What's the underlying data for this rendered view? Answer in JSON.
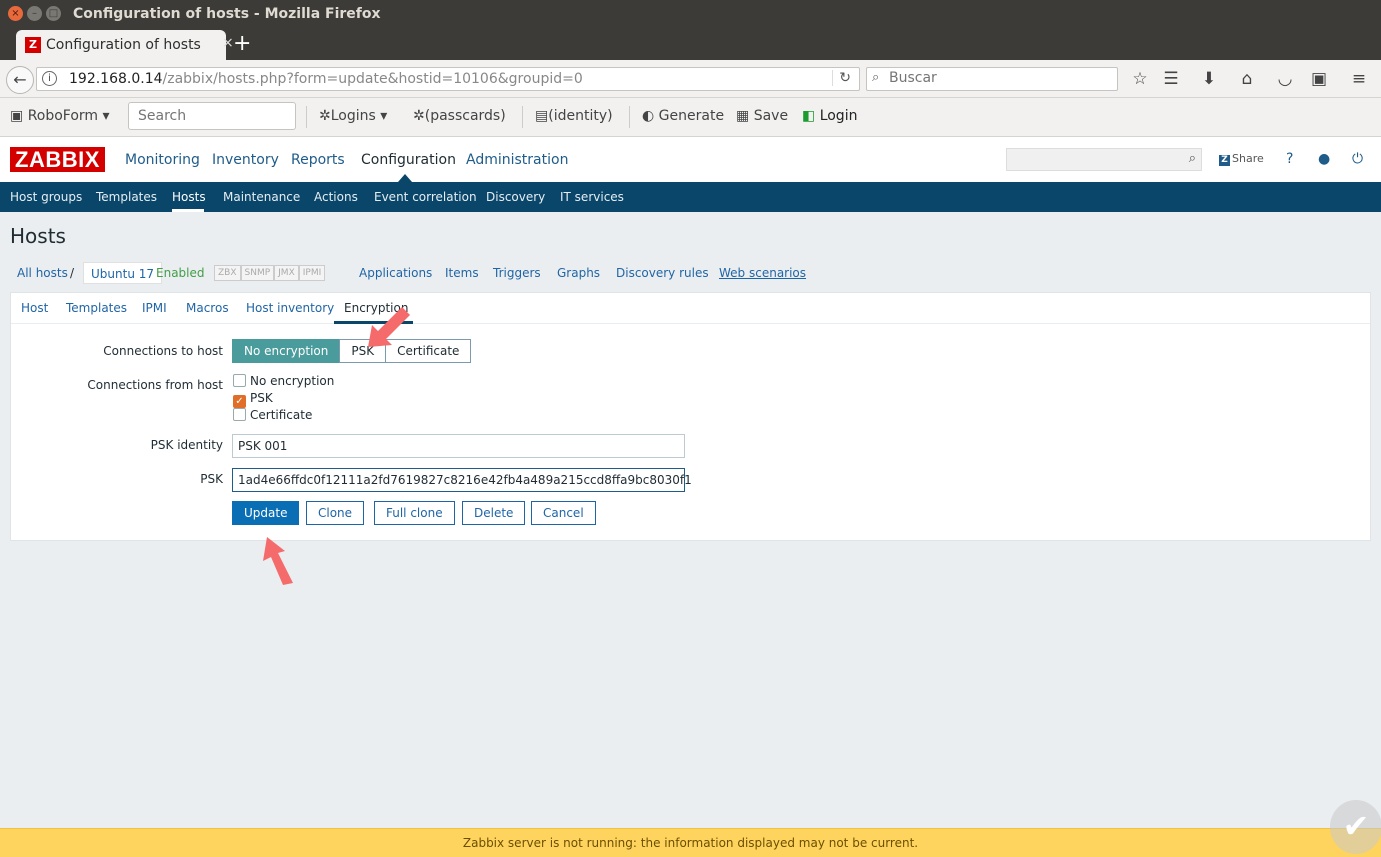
{
  "window": {
    "title": "Configuration of hosts - Mozilla Firefox",
    "tab_label": "Configuration of hosts",
    "tab_favicon": "Z"
  },
  "nav": {
    "url_host": "192.168.0.14",
    "url_path": "/zabbix/hosts.php?form=update&hostid=10106&groupid=0",
    "search_placeholder": "Buscar"
  },
  "roboform": {
    "brand": "RoboForm",
    "search_placeholder": "Search",
    "logins": "Logins",
    "passcards": "(passcards)",
    "identity": "(identity)",
    "generate": "Generate",
    "save": "Save",
    "login": "Login"
  },
  "zabbix": {
    "logo": "ZABBIX",
    "main_menu": [
      "Monitoring",
      "Inventory",
      "Reports",
      "Configuration",
      "Administration"
    ],
    "share": "Share",
    "sub_menu": [
      "Host groups",
      "Templates",
      "Hosts",
      "Maintenance",
      "Actions",
      "Event correlation",
      "Discovery",
      "IT services"
    ],
    "page_title": "Hosts",
    "breadcrumb": {
      "all_hosts": "All hosts",
      "separator": "/",
      "host": "Ubuntu 17",
      "status": "Enabled",
      "badges": [
        "ZBX",
        "SNMP",
        "JMX",
        "IPMI"
      ],
      "links": [
        "Applications",
        "Items",
        "Triggers",
        "Graphs",
        "Discovery rules",
        "Web scenarios"
      ]
    },
    "form_tabs": [
      "Host",
      "Templates",
      "IPMI",
      "Macros",
      "Host inventory",
      "Encryption"
    ],
    "form": {
      "connections_to_host_label": "Connections to host",
      "connections_to_host_options": [
        "No encryption",
        "PSK",
        "Certificate"
      ],
      "connections_from_host_label": "Connections from host",
      "connections_from_host_options": [
        "No encryption",
        "PSK",
        "Certificate"
      ],
      "psk_identity_label": "PSK identity",
      "psk_identity_value": "PSK 001",
      "psk_label": "PSK",
      "psk_value": "1ad4e66ffdc0f12111a2fd7619827c8216e42fb4a489a215ccd8ffa9bc8030f1"
    },
    "buttons": [
      "Update",
      "Clone",
      "Full clone",
      "Delete",
      "Cancel"
    ],
    "footer": "Zabbix server is not running: the information displayed may not be current."
  },
  "colors": {
    "brand_red": "#d40000",
    "nav_blue": "#0a466a",
    "segment_active": "#4a9b9b",
    "checkbox_checked": "#e06e28",
    "footer_yellow": "#ffd45e",
    "arrow": "#f56b6b"
  }
}
